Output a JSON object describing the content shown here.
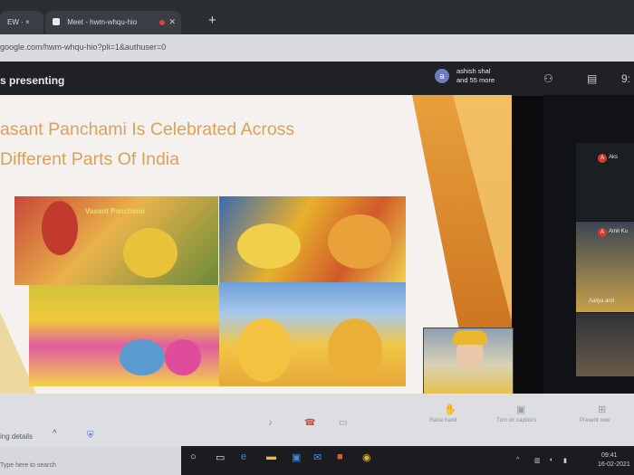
{
  "browser": {
    "tab1_title": "EW · ×",
    "tab2_title": "Meet - hwm-whqu-hio",
    "new_tab_symbol": "+",
    "url": "google.com/hwm-whqu-hio?pli=1&authuser=0"
  },
  "meet": {
    "presenting_label": "s presenting",
    "presenter_initial": "a",
    "presenter_name": "ashish shal",
    "presenter_more": "and 55 more",
    "participants_count_icon": "people-icon",
    "chat_icon": "chat-icon",
    "time_fragment": "9:"
  },
  "slide": {
    "title": "asant Panchami Is Celebrated Across\nDifferent Parts Of India",
    "photo_caption": "Vasant Panchami",
    "colors": {
      "title": "#d9a15b",
      "stripe": "#e8a03c"
    }
  },
  "participants": [
    {
      "initial": "A",
      "label": "Aks"
    },
    {
      "initial": "A",
      "label": "Amit Ku"
    },
    {
      "initial": "",
      "label": "Aaliya and"
    }
  ],
  "controls": {
    "meeting_details": "ing details",
    "chevron": "^",
    "raise_hand": "Raise hand",
    "turn_on_captions": "Turn on captions",
    "present_now": "Present now"
  },
  "taskbar": {
    "left_text": "Type here to search",
    "tray_time": "09:41",
    "tray_date": "16-02-2021"
  }
}
